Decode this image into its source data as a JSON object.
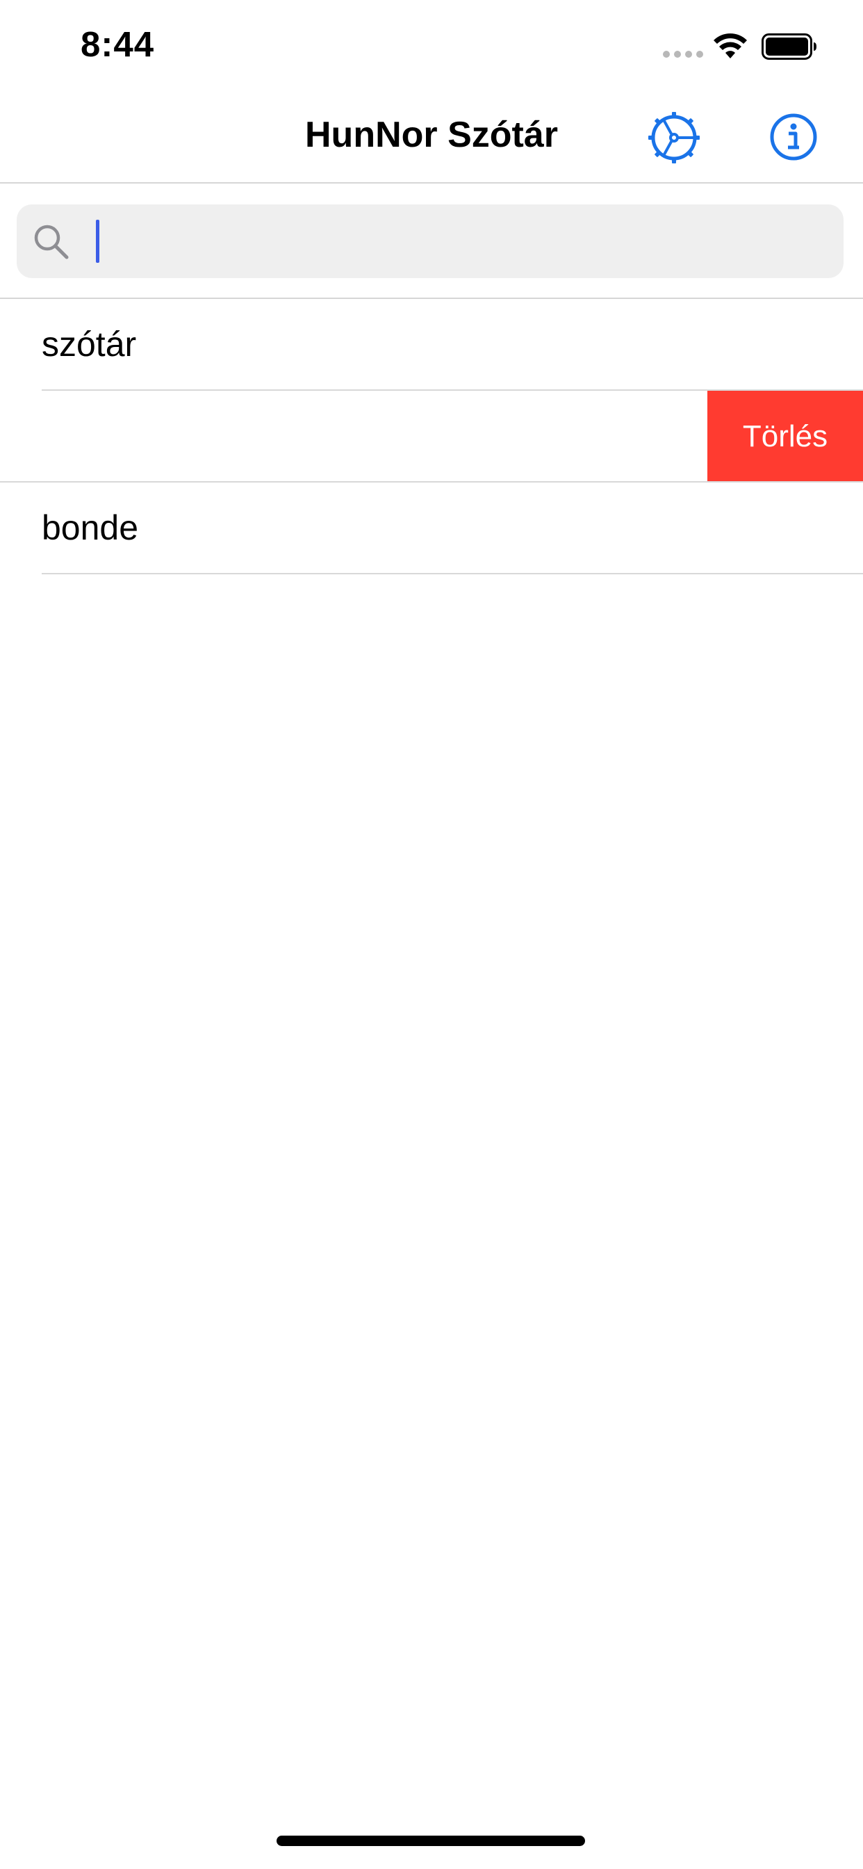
{
  "status_bar": {
    "time": "8:44",
    "icons": [
      "cellular-dots-icon",
      "wifi-icon",
      "battery-icon"
    ]
  },
  "nav": {
    "title": "HunNor Szótár",
    "settings_icon": "settings-gear-icon",
    "info_icon": "info-icon"
  },
  "search": {
    "value": "",
    "placeholder": "",
    "icon": "search-icon"
  },
  "history": {
    "items": [
      {
        "label": "szótár"
      },
      {
        "label": "",
        "delete_label": "Törlés"
      },
      {
        "label": "bonde"
      }
    ]
  },
  "colors": {
    "accent": "#1a73e8",
    "destructive": "#ff3b30",
    "separator": "#d8d8d8",
    "search_bg": "#efefef",
    "cursor": "#3b5de7"
  }
}
